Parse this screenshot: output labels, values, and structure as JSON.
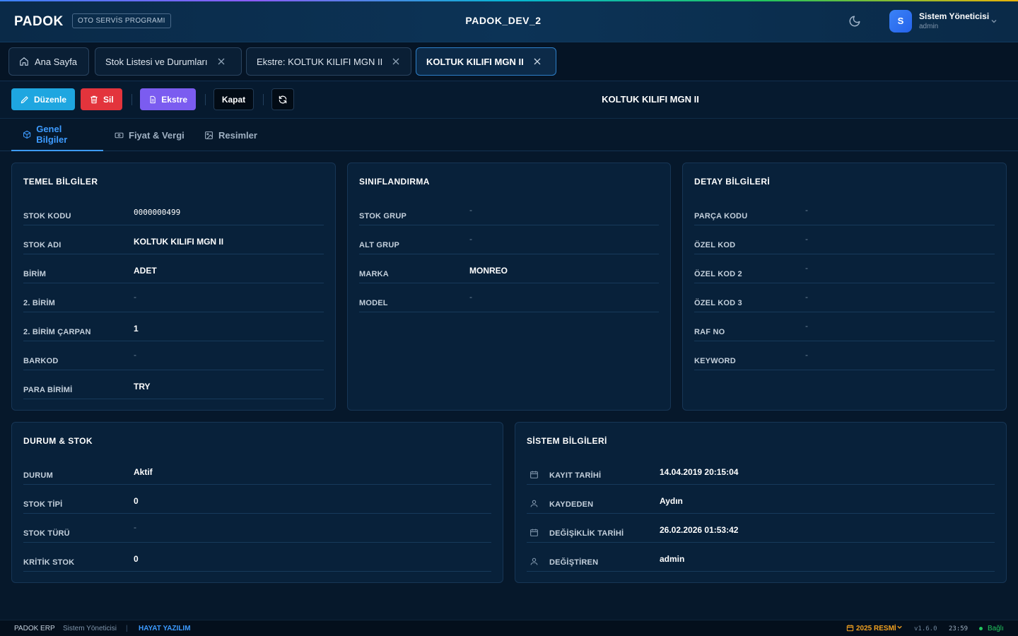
{
  "header": {
    "brand": "PADOK",
    "brand_tag": "OTO SERVİS PROGRAMI",
    "env_title": "PADOK_DEV_2",
    "user_initial": "S",
    "user_name": "Sistem Yöneticisi",
    "user_role": "admin"
  },
  "tabs": [
    {
      "label": "Ana Sayfa"
    },
    {
      "label": "Stok Listesi ve Durumları"
    },
    {
      "label": "Ekstre: KOLTUK KILIFI MGN II"
    },
    {
      "label": "KOLTUK KILIFI MGN II"
    }
  ],
  "toolbar": {
    "edit_label": "Düzenle",
    "delete_label": "Sil",
    "statement_label": "Ekstre",
    "close_label": "Kapat",
    "title": "KOLTUK KILIFI MGN II"
  },
  "subtabs": [
    {
      "label": "Genel Bilgiler"
    },
    {
      "label": "Fiyat & Vergi"
    },
    {
      "label": "Resimler"
    }
  ],
  "basic": {
    "title": "TEMEL BİLGİLER",
    "rows": [
      {
        "label": "STOK KODU",
        "value": "0000000499"
      },
      {
        "label": "STOK ADI",
        "value": "KOLTUK KILIFI MGN II"
      },
      {
        "label": "BİRİM",
        "value": "ADET"
      },
      {
        "label": "2. BİRİM",
        "value": "-"
      },
      {
        "label": "2. BİRİM ÇARPAN",
        "value": "1"
      },
      {
        "label": "BARKOD",
        "value": "-"
      },
      {
        "label": "PARA BİRİMİ",
        "value": "TRY"
      }
    ]
  },
  "classification": {
    "title": "SINIFLANDIRMA",
    "rows": [
      {
        "label": "STOK GRUP",
        "value": "-"
      },
      {
        "label": "ALT GRUP",
        "value": "-"
      },
      {
        "label": "MARKA",
        "value": "MONREO"
      },
      {
        "label": "MODEL",
        "value": "-"
      }
    ]
  },
  "details": {
    "title": "DETAY BİLGİLERİ",
    "rows": [
      {
        "label": "PARÇA KODU",
        "value": "-"
      },
      {
        "label": "ÖZEL KOD",
        "value": "-"
      },
      {
        "label": "ÖZEL KOD 2",
        "value": "-"
      },
      {
        "label": "ÖZEL KOD 3",
        "value": "-"
      },
      {
        "label": "RAF NO",
        "value": "-"
      },
      {
        "label": "KEYWORD",
        "value": "-"
      }
    ]
  },
  "status": {
    "title": "DURUM & STOK",
    "rows": [
      {
        "label": "DURUM",
        "value": "Aktif"
      },
      {
        "label": "STOK TİPİ",
        "value": "0"
      },
      {
        "label": "STOK TÜRÜ",
        "value": "-"
      },
      {
        "label": "KRİTİK STOK",
        "value": "0"
      }
    ]
  },
  "system": {
    "title": "SİSTEM BİLGİLERİ",
    "rows": [
      {
        "label": "KAYIT TARİHİ",
        "value": "14.04.2019 20:15:04",
        "icon": "calendar-icon"
      },
      {
        "label": "KAYDEDEN",
        "value": "Aydın",
        "icon": "user-icon"
      },
      {
        "label": "DEĞİŞİKLİK TARİHİ",
        "value": "26.02.2026 01:53:42",
        "icon": "calendar-icon"
      },
      {
        "label": "DEĞİŞTİREN",
        "value": "admin",
        "icon": "user-icon"
      }
    ]
  },
  "footer": {
    "app": "PADOK ERP",
    "user": "Sistem Yöneticisi",
    "company": "HAYAT YAZILIM",
    "period": "2025 RESMİ",
    "version": "v1.6.0",
    "time": "23:59",
    "connection": "Bağlı"
  },
  "colors": {
    "accent": "#3d9bff",
    "edit": "#1ea6e0",
    "delete": "#e3343c",
    "statement": "#7b5cf0",
    "period": "#f0a020",
    "connected": "#22c55e"
  }
}
